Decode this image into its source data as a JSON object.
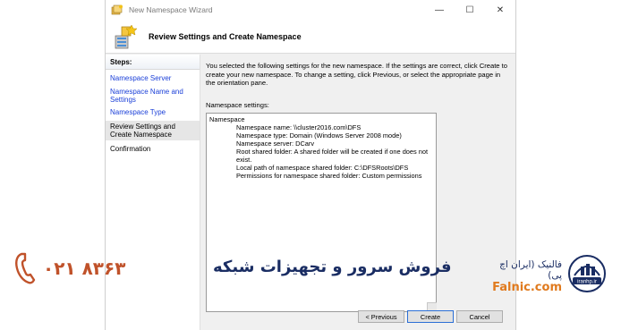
{
  "window": {
    "title": "New Namespace Wizard",
    "controls": {
      "minimize": "—",
      "maximize": "☐",
      "close": "✕"
    }
  },
  "header": {
    "title": "Review Settings and Create Namespace"
  },
  "steps": {
    "label": "Steps:",
    "items": [
      {
        "label": "Namespace Server",
        "state": "link"
      },
      {
        "label": "Namespace Name and Settings",
        "state": "link"
      },
      {
        "label": "Namespace Type",
        "state": "link"
      },
      {
        "label": "Review Settings and Create Namespace",
        "state": "active"
      },
      {
        "label": "Confirmation",
        "state": "plain"
      }
    ]
  },
  "content": {
    "intro": "You selected the following settings for the new namespace. If the settings are correct, click Create to create your new namespace. To change a setting, click Previous, or select the appropriate page in the orientation pane.",
    "settings_label": "Namespace settings:",
    "settings_heading": "Namespace",
    "settings_lines": [
      "Namespace name:  \\\\cluster2016.com\\DFS",
      "Namespace type:  Domain (Windows Server 2008 mode)",
      "Namespace server:  DCarv",
      "Root shared folder:  A shared folder will be created if one does not exist.",
      "Local path of namespace shared folder: C:\\DFSRoots\\DFS",
      "Permissions for namespace shared folder: Custom permissions"
    ]
  },
  "buttons": {
    "previous": "< Previous",
    "create": "Create",
    "cancel": "Cancel"
  },
  "watermark": {
    "phone": "۰۲۱ ۸۳۶۳",
    "tagline": "فروش سرور و تجهیزات شبکه",
    "brand_fa": "فالنیک (ایران اچ پی)",
    "brand_en": "Falnic.com",
    "logo_text": "iranhp.ir",
    "colors": {
      "orange": "#e07a1e",
      "navy": "#1a2d63",
      "phone": "#c0522a"
    }
  }
}
